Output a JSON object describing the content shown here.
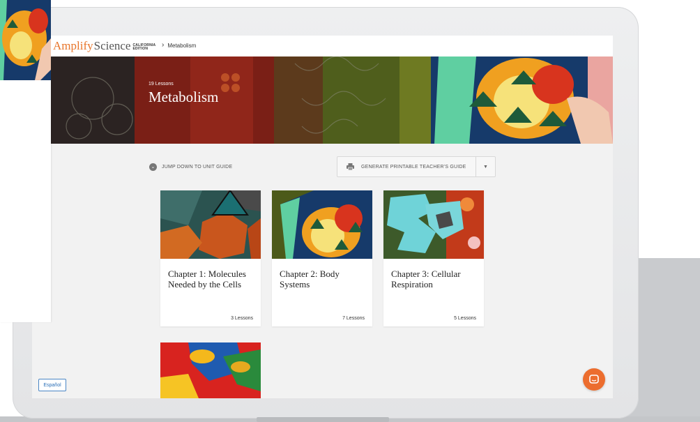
{
  "logo": {
    "amplify": "Amplify",
    "science": "Science",
    "edition_line1": "CALIFORNIA",
    "edition_line2": "EDITION"
  },
  "breadcrumb": {
    "separator": "›",
    "current": "Metabolism"
  },
  "hero": {
    "lesson_count": "19 Lessons",
    "title": "Metabolism"
  },
  "actions": {
    "jump_label": "JUMP DOWN TO UNIT GUIDE",
    "jump_icon": "chevron-down-icon",
    "generate_label": "GENERATE PRINTABLE TEACHER'S GUIDE",
    "generate_icon": "printer-icon",
    "dropdown_icon": "caret-down-icon"
  },
  "chapters": [
    {
      "title": "Chapter 1: Molecules Needed by the Cells",
      "lessons": "3 Lessons"
    },
    {
      "title": "Chapter 2: Body Systems",
      "lessons": "7 Lessons"
    },
    {
      "title": "Chapter 3: Cellular Respiration",
      "lessons": "5 Lessons"
    }
  ],
  "footer": {
    "language_button": "Español",
    "chat_icon": "chat-icon"
  },
  "colors": {
    "brand_orange": "#e8752a",
    "chat_orange": "#ec6d2e",
    "link_blue": "#2a6fb7"
  }
}
